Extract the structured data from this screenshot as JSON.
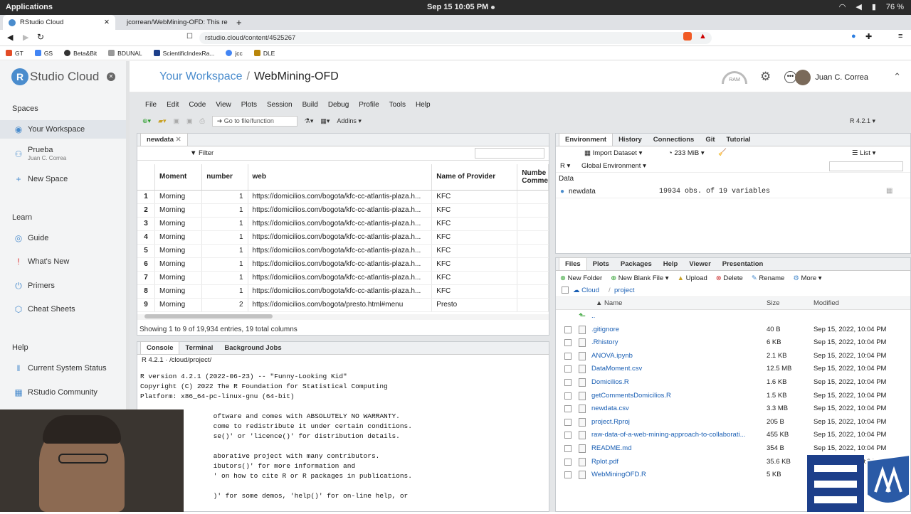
{
  "os": {
    "apps": "Applications",
    "clock": "Sep 15  10:05 PM",
    "battery": "76 %"
  },
  "browser": {
    "tabs": [
      {
        "label": "RStudio Cloud"
      },
      {
        "label": "jcorrean/WebMining-OFD: This re"
      }
    ],
    "url": "rstudio.cloud/content/4525267",
    "bookmarks": [
      "GT",
      "GS",
      "Beta&Bit",
      "BDUNAL",
      "ScientificIndexRa...",
      "jcc",
      "DLE"
    ]
  },
  "sidebar": {
    "logo_r": "R",
    "logo": "Studio Cloud",
    "spaces_heading": "Spaces",
    "spaces": [
      {
        "label": "Your Workspace"
      },
      {
        "label": "Prueba",
        "sub": "Juan C. Correa"
      },
      {
        "label": "New Space"
      }
    ],
    "learn_heading": "Learn",
    "learn": [
      "Guide",
      "What's New",
      "Primers",
      "Cheat Sheets"
    ],
    "help_heading": "Help",
    "help": [
      "Current System Status",
      "RStudio Community"
    ]
  },
  "header": {
    "workspace": "Your Workspace",
    "sep": "/",
    "project": "WebMining-OFD",
    "user": "Juan C. Correa",
    "ram": "RAM"
  },
  "menu": [
    "File",
    "Edit",
    "Code",
    "View",
    "Plots",
    "Session",
    "Build",
    "Debug",
    "Profile",
    "Tools",
    "Help"
  ],
  "toolbar": {
    "goto": "Go to file/function",
    "addins": "Addins",
    "rversion": "R 4.2.1"
  },
  "dataviewer": {
    "tab": "newdata",
    "filter": "Filter",
    "columns": [
      "",
      "Moment",
      "number",
      "web",
      "Name of Provider",
      "Numbe Comme"
    ],
    "rows": [
      [
        "1",
        "Morning",
        "1",
        "https://domicilios.com/bogota/kfc-cc-atlantis-plaza.h...",
        "KFC"
      ],
      [
        "2",
        "Morning",
        "1",
        "https://domicilios.com/bogota/kfc-cc-atlantis-plaza.h...",
        "KFC"
      ],
      [
        "3",
        "Morning",
        "1",
        "https://domicilios.com/bogota/kfc-cc-atlantis-plaza.h...",
        "KFC"
      ],
      [
        "4",
        "Morning",
        "1",
        "https://domicilios.com/bogota/kfc-cc-atlantis-plaza.h...",
        "KFC"
      ],
      [
        "5",
        "Morning",
        "1",
        "https://domicilios.com/bogota/kfc-cc-atlantis-plaza.h...",
        "KFC"
      ],
      [
        "6",
        "Morning",
        "1",
        "https://domicilios.com/bogota/kfc-cc-atlantis-plaza.h...",
        "KFC"
      ],
      [
        "7",
        "Morning",
        "1",
        "https://domicilios.com/bogota/kfc-cc-atlantis-plaza.h...",
        "KFC"
      ],
      [
        "8",
        "Morning",
        "1",
        "https://domicilios.com/bogota/kfc-cc-atlantis-plaza.h...",
        "KFC"
      ],
      [
        "9",
        "Morning",
        "2",
        "https://domicilios.com/bogota/presto.html#menu",
        "Presto"
      ]
    ],
    "footer": "Showing 1 to 9 of 19,934 entries, 19 total columns"
  },
  "console": {
    "tabs": [
      "Console",
      "Terminal",
      "Background Jobs"
    ],
    "path": "R 4.2.1 · /cloud/project/",
    "lines": [
      "R version 4.2.1 (2022-06-23) -- \"Funny-Looking Kid\"",
      "Copyright (C) 2022 The R Foundation for Statistical Computing",
      "Platform: x86_64-pc-linux-gnu (64-bit)",
      "",
      "                  oftware and comes with ABSOLUTELY NO WARRANTY.",
      "                  come to redistribute it under certain conditions.",
      "                  se()' or 'licence()' for distribution details.",
      "",
      "                  aborative project with many contributors.",
      "                  ibutors()' for more information and",
      "                  ' on how to cite R or R packages in publications.",
      "",
      "                  )' for some demos, 'help()' for on-line help, or"
    ]
  },
  "environment": {
    "tabs": [
      "Environment",
      "History",
      "Connections",
      "Git",
      "Tutorial"
    ],
    "import": "Import Dataset",
    "mem": "233 MiB",
    "list": "List",
    "lang": "R",
    "scope": "Global Environment",
    "section": "Data",
    "items": [
      {
        "name": "newdata",
        "value": "19934 obs. of 19 variables"
      }
    ]
  },
  "files": {
    "tabs": [
      "Files",
      "Plots",
      "Packages",
      "Help",
      "Viewer",
      "Presentation"
    ],
    "actions": [
      "New Folder",
      "New Blank File",
      "Upload",
      "Delete",
      "Rename",
      "More"
    ],
    "path": [
      "Cloud",
      "project"
    ],
    "headers": [
      "Name",
      "Size",
      "Modified"
    ],
    "rows": [
      {
        "name": "..",
        "size": "",
        "mod": ""
      },
      {
        "name": ".gitignore",
        "size": "40 B",
        "mod": "Sep 15, 2022, 10:04 PM"
      },
      {
        "name": ".Rhistory",
        "size": "6 KB",
        "mod": "Sep 15, 2022, 10:04 PM"
      },
      {
        "name": "ANOVA.ipynb",
        "size": "2.1 KB",
        "mod": "Sep 15, 2022, 10:04 PM"
      },
      {
        "name": "DataMoment.csv",
        "size": "12.5 MB",
        "mod": "Sep 15, 2022, 10:04 PM"
      },
      {
        "name": "Domicilios.R",
        "size": "1.6 KB",
        "mod": "Sep 15, 2022, 10:04 PM"
      },
      {
        "name": "getCommentsDomicilios.R",
        "size": "1.5 KB",
        "mod": "Sep 15, 2022, 10:04 PM"
      },
      {
        "name": "newdata.csv",
        "size": "3.3 MB",
        "mod": "Sep 15, 2022, 10:04 PM"
      },
      {
        "name": "project.Rproj",
        "size": "205 B",
        "mod": "Sep 15, 2022, 10:04 PM"
      },
      {
        "name": "raw-data-of-a-web-mining-approach-to-collaborati...",
        "size": "455 KB",
        "mod": "Sep 15, 2022, 10:04 PM"
      },
      {
        "name": "README.md",
        "size": "354 B",
        "mod": "Sep 15, 2022, 10:04 PM"
      },
      {
        "name": "Rplot.pdf",
        "size": "35.6 KB",
        "mod": "Sep 15, 2022, 10:04 PM"
      },
      {
        "name": "WebMiningOFD.R",
        "size": "5 KB",
        "mod": ""
      }
    ]
  },
  "colors": {
    "accent": "#4a8ccd",
    "link": "#1a5fb4",
    "brand": "#1d3f8a"
  }
}
